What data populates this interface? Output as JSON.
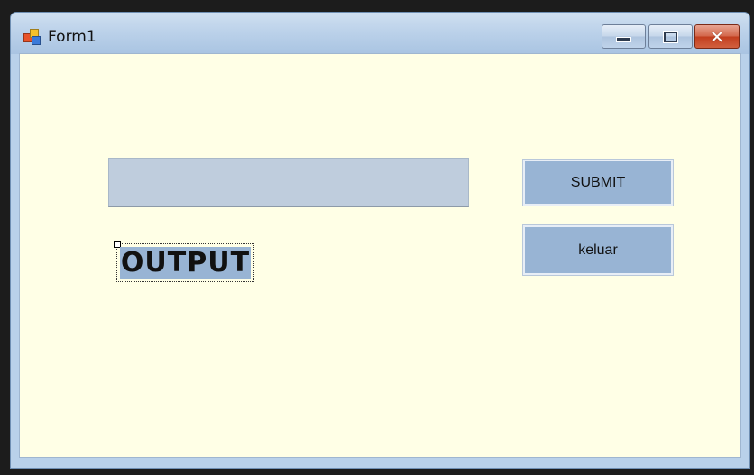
{
  "window": {
    "title": "Form1",
    "controls": {
      "minimize": "minimize",
      "maximize": "maximize",
      "close": "✕"
    },
    "icon": "winforms-app-icon"
  },
  "form": {
    "input": {
      "value": "",
      "placeholder": ""
    },
    "submit_label": "SUBMIT",
    "exit_label": "keluar",
    "output_label": "OUTPUT"
  },
  "colors": {
    "form_background": "#ffffe6",
    "button_fill": "#98b4d4",
    "textbox_fill": "#bfcddd",
    "close_button": "#c23e1e"
  }
}
